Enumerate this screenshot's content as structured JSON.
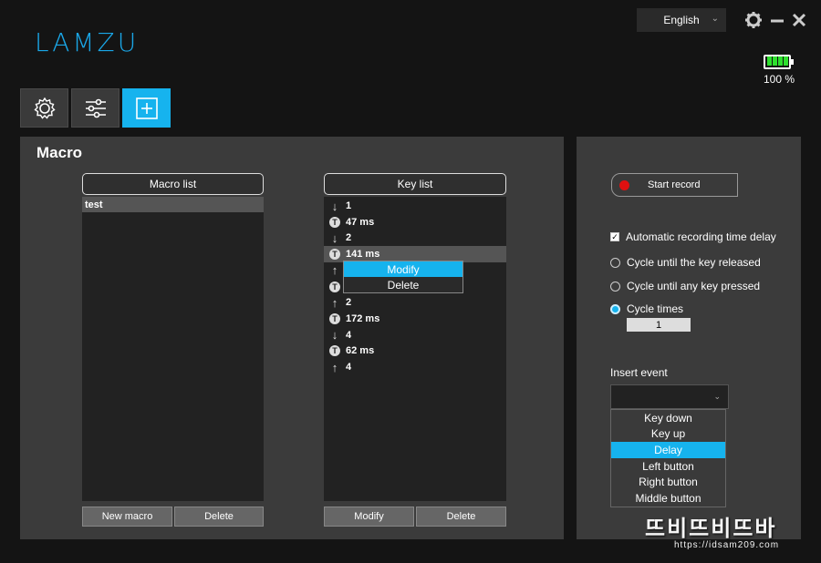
{
  "app": {
    "logo": "LAMZU"
  },
  "header": {
    "language": "English",
    "battery_text": "100 %",
    "battery_level": 1.0
  },
  "tabs": [
    {
      "name": "settings",
      "icon": "gear-icon"
    },
    {
      "name": "adjust",
      "icon": "sliders-icon"
    },
    {
      "name": "macro",
      "icon": "plus-square-icon",
      "active": true
    }
  ],
  "main": {
    "title": "Macro",
    "macro_list": {
      "header": "Macro list",
      "items": [
        "test"
      ],
      "buttons": {
        "new": "New macro",
        "delete": "Delete"
      }
    },
    "key_list": {
      "header": "Key list",
      "items": [
        {
          "type": "down",
          "text": "1"
        },
        {
          "type": "delay",
          "text": "47 ms"
        },
        {
          "type": "down",
          "text": "2"
        },
        {
          "type": "delay",
          "text": "141 ms"
        },
        {
          "type": "up",
          "text": ""
        },
        {
          "type": "delay",
          "text": ""
        },
        {
          "type": "up",
          "text": "2"
        },
        {
          "type": "delay",
          "text": "172 ms"
        },
        {
          "type": "down",
          "text": "4"
        },
        {
          "type": "delay",
          "text": "62 ms"
        },
        {
          "type": "up",
          "text": "4"
        }
      ],
      "buttons": {
        "modify": "Modify",
        "delete": "Delete"
      },
      "context_menu": [
        "Modify",
        "Delete"
      ]
    }
  },
  "side": {
    "start_record": "Start record",
    "auto_delay": "Automatic recording time delay",
    "opt_released": "Cycle until the key released",
    "opt_any_key": "Cycle until any key pressed",
    "opt_cycle_times": "Cycle times",
    "cycle_times_value": "1",
    "insert_event_label": "Insert event",
    "insert_event_options": [
      "Key down",
      "Key up",
      "Delay",
      "Left button",
      "Right button",
      "Middle button"
    ],
    "insert_event_selected": "Delay"
  },
  "watermark": {
    "big": "뜨비뜨비뜨바",
    "small": "https://idsam209.com"
  },
  "colors": {
    "accent": "#16b3ee",
    "background": "#141414",
    "panel": "#3b3b3b",
    "record_dot": "#e01010"
  }
}
